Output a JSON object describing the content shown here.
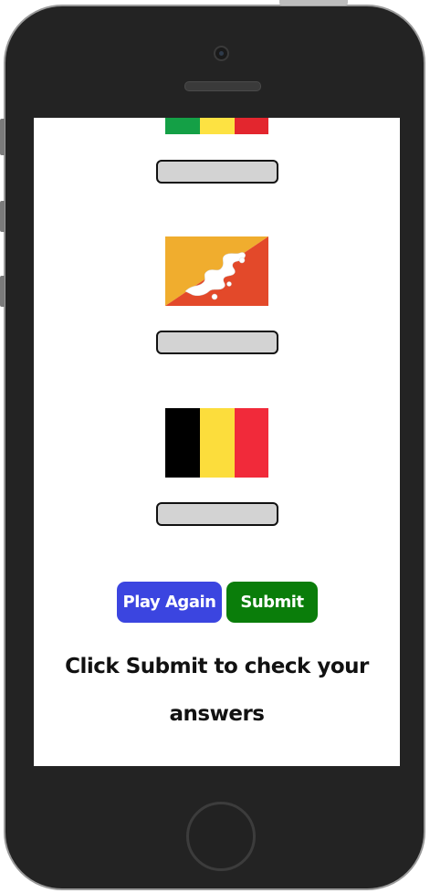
{
  "colors": {
    "play_again": "#3b45e0",
    "submit": "#0a7d0a",
    "answer_field": "#d3d3d3",
    "phone_body": "#232323"
  },
  "quiz": {
    "flags": [
      {
        "icon": "mali-flag-icon",
        "answer_value": ""
      },
      {
        "icon": "bhutan-flag-icon",
        "answer_value": ""
      },
      {
        "icon": "belgium-flag-icon",
        "answer_value": ""
      }
    ],
    "play_again_label": "Play Again",
    "submit_label": "Submit",
    "message": "Click Submit to check your answers"
  }
}
